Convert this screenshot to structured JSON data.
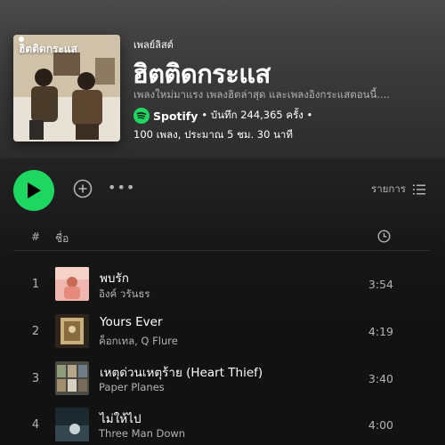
{
  "playlist": {
    "cover_title": "ฮิตติดกระแส",
    "type_label": "เพลย์ลิสต์",
    "title": "ฮิตติดกระแส",
    "description": "เพลงใหม่มาแรง เพลงฮิตล่าสุด และเพลงอิงกระแสตอนนี้....",
    "owner": "Spotify",
    "saves_text": "• บันทึก 244,365 ครั้ง •",
    "summary": "100 เพลง, ประมาณ 5 ชม. 30 นาที"
  },
  "controls": {
    "play_icon": "play-icon",
    "add_icon": "add-circle-icon",
    "more_icon": "more-horizontal-icon",
    "more_glyph": "•••",
    "list_label": "รายการ",
    "list_icon": "list-icon"
  },
  "columns": {
    "num": "#",
    "title": "ชื่อ",
    "duration_icon": "clock-icon"
  },
  "tracks": [
    {
      "num": "1",
      "title": "พบรัก",
      "artist": "อิงค์ วรันธร",
      "duration": "3:54"
    },
    {
      "num": "2",
      "title": "Yours Ever",
      "artist": "ค็อกเทล, Q Flure",
      "duration": "4:19"
    },
    {
      "num": "3",
      "title": "เหตุด่วนเหตุร้าย (Heart Thief)",
      "artist": "Paper Planes",
      "duration": "3:40"
    },
    {
      "num": "4",
      "title": "ไม่ให้ไป",
      "artist": "Three Man Down",
      "duration": "4:00"
    }
  ],
  "colors": {
    "accent": "#1ed760",
    "background": "#121212",
    "text_secondary": "#b3b3b3"
  }
}
